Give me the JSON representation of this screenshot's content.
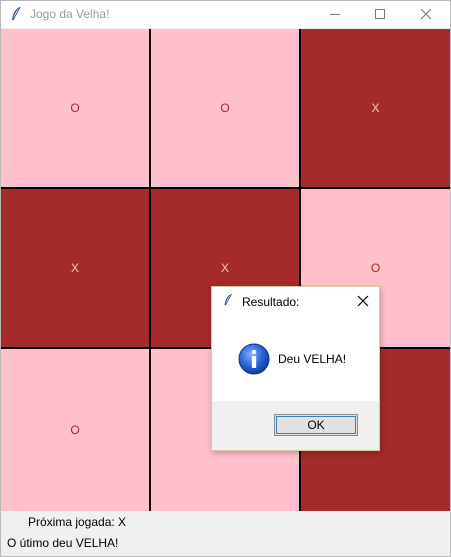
{
  "window": {
    "title": "Jogo da Velha!"
  },
  "board": {
    "colors": {
      "light": "#ffc0cb",
      "dark": "#a52a2a"
    },
    "cells": [
      {
        "mark": "O",
        "shade": "light"
      },
      {
        "mark": "O",
        "shade": "light"
      },
      {
        "mark": "X",
        "shade": "dark"
      },
      {
        "mark": "X",
        "shade": "dark"
      },
      {
        "mark": "X",
        "shade": "dark"
      },
      {
        "mark": "O",
        "shade": "light"
      },
      {
        "mark": "O",
        "shade": "light"
      },
      {
        "mark": "",
        "shade": "light"
      },
      {
        "mark": "",
        "shade": "dark"
      }
    ]
  },
  "status": {
    "next_move": "Próxima jogada: X",
    "last_result": "O útimo deu VELHA!"
  },
  "dialog": {
    "title": "Resultado:",
    "message": "Deu VELHA!",
    "ok_label": "OK",
    "icon": "info-icon"
  }
}
